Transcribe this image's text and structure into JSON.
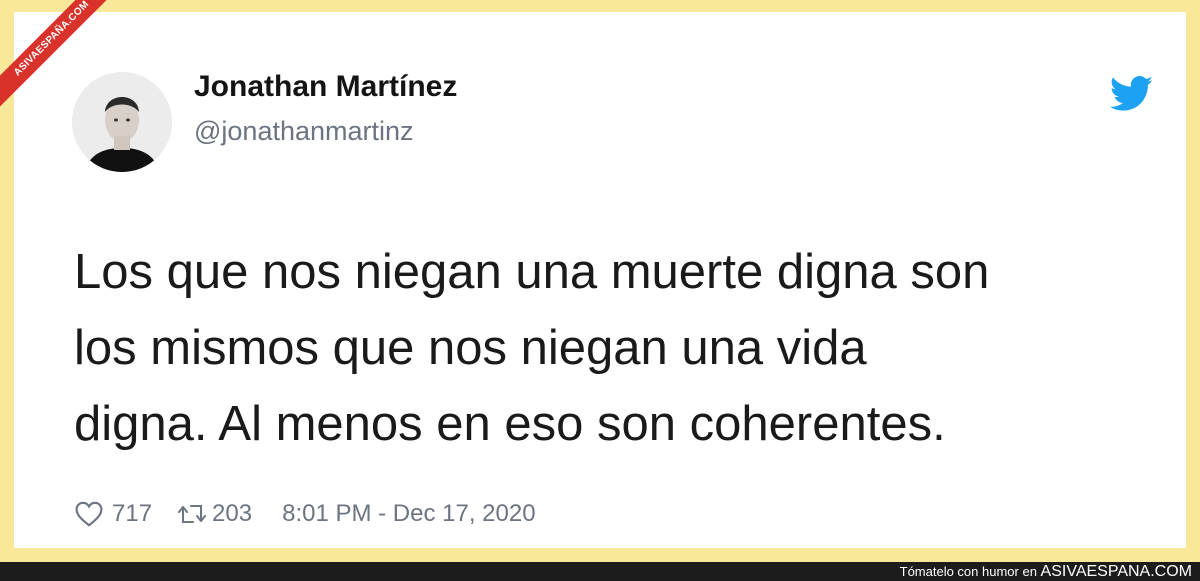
{
  "watermark": {
    "ribbon_text": "ASIVAESPAÑA.COM"
  },
  "tweet": {
    "author_name": "Jonathan Martínez",
    "author_handle": "@jonathanmartinz",
    "text_lines": [
      "Los que nos niegan una muerte digna son",
      "los mismos que nos niegan una vida",
      "digna. Al menos en eso son coherentes."
    ],
    "likes": "717",
    "retweets": "203",
    "timestamp": "8:01 PM - Dec 17, 2020"
  },
  "footer_bar": {
    "tagline": "Tómatelo con humor en",
    "site": "ASIVAESPANA.COM"
  },
  "colors": {
    "frame": "#f9e79a",
    "twitter_blue": "#1da1f2",
    "ribbon_red": "#d9322b",
    "muted_text": "#6b7480"
  },
  "icons": [
    "twitter-bird-icon",
    "heart-icon",
    "retweet-icon"
  ]
}
